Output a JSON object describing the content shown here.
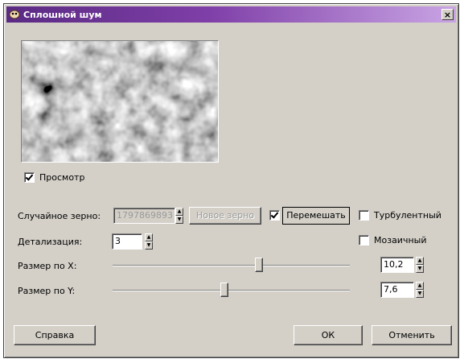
{
  "window": {
    "title": "Сплошной шум",
    "close_glyph": "×"
  },
  "preview": {
    "label": "Просмотр",
    "checked": true
  },
  "seed": {
    "label": "Случайное зерно:",
    "value": "1797869893",
    "new_seed_button": "Новое зерно"
  },
  "shuffle": {
    "label": "Перемешать",
    "checked": true
  },
  "turbulent": {
    "label": "Турбулентный",
    "checked": false
  },
  "detail": {
    "label": "Детализация:",
    "value": "3"
  },
  "tileable": {
    "label": "Мозаичный",
    "checked": false
  },
  "size_x": {
    "label": "Размер по X:",
    "value": "10,2",
    "slider_fraction": 0.62
  },
  "size_y": {
    "label": "Размер по Y:",
    "value": "7,6",
    "slider_fraction": 0.47
  },
  "buttons": {
    "help": "Справка",
    "ok": "ОК",
    "cancel": "Отменить"
  },
  "icons": {
    "title_icon": "gimp-icon",
    "spin_up": "▲",
    "spin_down": "▼"
  }
}
